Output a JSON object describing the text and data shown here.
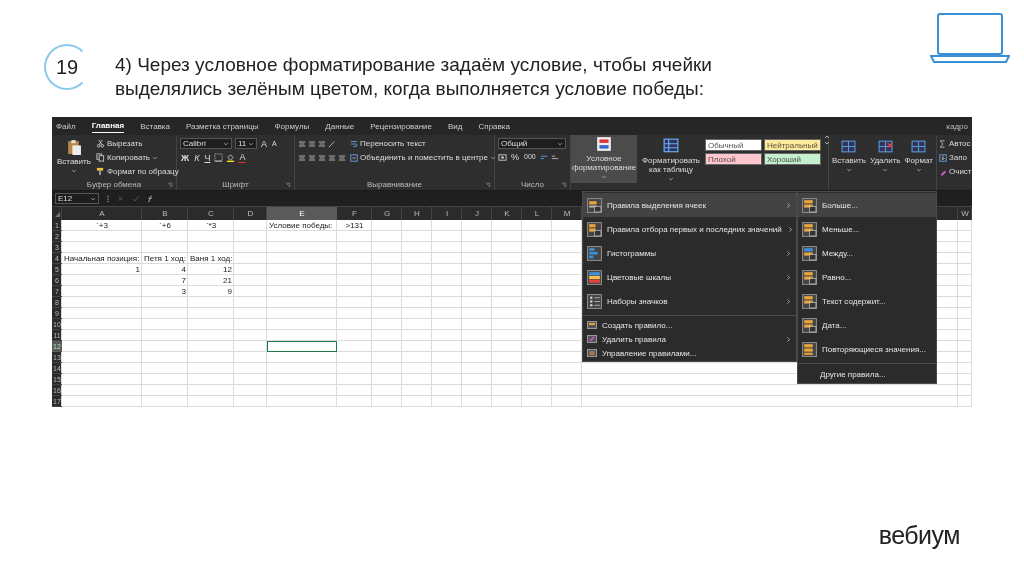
{
  "slide": {
    "number": "19",
    "heading": "4) Через условное форматирование задаём условие, чтобы ячейки выделялись зелёным цветом, когда выполняется условие победы:",
    "brand": "вебиум"
  },
  "excel": {
    "tabs": [
      {
        "label": "Файл",
        "selected": false
      },
      {
        "label": "Главная",
        "selected": true
      },
      {
        "label": "Вставка",
        "selected": false
      },
      {
        "label": "Разметка страницы",
        "selected": false
      },
      {
        "label": "Формулы",
        "selected": false
      },
      {
        "label": "Данные",
        "selected": false
      },
      {
        "label": "Рецензирование",
        "selected": false
      },
      {
        "label": "Вид",
        "selected": false
      },
      {
        "label": "Справка",
        "selected": false
      }
    ],
    "account": "кадро",
    "clipboard": {
      "paste": "Вставить",
      "cut": "Вырезать",
      "copy": "Копировать",
      "format_painter": "Формат по образцу",
      "label": "Буфер обмена"
    },
    "font": {
      "name": "Calibri",
      "size": "11",
      "grow": "A",
      "shrink": "A",
      "bold": "Ж",
      "italic": "К",
      "underline": "Ч",
      "color_letter": "A",
      "label": "Шрифт"
    },
    "alignment": {
      "wrap": "Переносить текст",
      "merge": "Объединить и поместить в центре",
      "label": "Выравнивание"
    },
    "number": {
      "format": "Общий",
      "percent": "%",
      "thousands": "000",
      "label": "Число"
    },
    "styles": {
      "conditional": {
        "label": "Условное форматирование",
        "selected": true
      },
      "format_table": "Форматировать как таблицу",
      "cell_styles": [
        {
          "label": "Обычный",
          "color": "#ffffff"
        },
        {
          "label": "Нейтральный",
          "color": "#ffeb9c"
        },
        {
          "label": "Плохой",
          "color": "#ffc7ce"
        },
        {
          "label": "Хороший",
          "color": "#c6efce"
        }
      ]
    },
    "cells_group": [
      "Вставить",
      "Удалить",
      "Формат"
    ],
    "editing": [
      "Автос",
      "Запо",
      "Очист"
    ],
    "name_box": "E12",
    "columns": [
      {
        "label": "A",
        "selected": false
      },
      {
        "label": "B",
        "selected": false
      },
      {
        "label": "C",
        "selected": false
      },
      {
        "label": "D",
        "selected": false
      },
      {
        "label": "E",
        "selected": true
      },
      {
        "label": "F",
        "selected": false
      },
      {
        "label": "G",
        "selected": false
      },
      {
        "label": "H",
        "selected": false
      },
      {
        "label": "I",
        "selected": false
      },
      {
        "label": "J",
        "selected": false
      },
      {
        "label": "K",
        "selected": false
      },
      {
        "label": "L",
        "selected": false
      },
      {
        "label": "M",
        "selected": false
      },
      {
        "label": "W",
        "selected": false
      }
    ],
    "rows": [
      {
        "number": "1",
        "selected": false,
        "cells": [
          {
            "kind": "centered",
            "text": "`+3"
          },
          {
            "kind": "centered",
            "text": "`+6"
          },
          {
            "kind": "centered",
            "text": "`*3"
          },
          {
            "kind": "blank"
          },
          {
            "kind": "text",
            "text": "Условие победы:"
          },
          {
            "kind": "centered",
            "text": ">131"
          }
        ]
      },
      {
        "number": "2",
        "selected": false
      },
      {
        "number": "3",
        "selected": false
      },
      {
        "number": "4",
        "selected": false,
        "cells": [
          {
            "kind": "text",
            "text": "Начальная позиция:"
          },
          {
            "kind": "text",
            "text": "Петя 1 ход:"
          },
          {
            "kind": "text",
            "text": "Ваня 1 ход:"
          }
        ]
      },
      {
        "number": "5",
        "selected": false,
        "cells": [
          {
            "kind": "number",
            "text": "1"
          },
          {
            "kind": "number",
            "text": "4"
          },
          {
            "kind": "number",
            "text": "12"
          }
        ]
      },
      {
        "number": "6",
        "selected": false,
        "cells": [
          {
            "kind": "blank"
          },
          {
            "kind": "number",
            "text": "7"
          },
          {
            "kind": "number",
            "text": "21"
          }
        ]
      },
      {
        "number": "7",
        "selected": false,
        "cells": [
          {
            "kind": "blank"
          },
          {
            "kind": "number",
            "text": "3"
          },
          {
            "kind": "number",
            "text": "9"
          }
        ]
      },
      {
        "number": "8",
        "selected": false
      },
      {
        "number": "9",
        "selected": false
      },
      {
        "number": "10",
        "selected": false
      },
      {
        "number": "11",
        "selected": false
      },
      {
        "number": "12",
        "selected": true
      },
      {
        "number": "13",
        "selected": false
      },
      {
        "number": "14",
        "selected": false
      },
      {
        "number": "15",
        "selected": false
      },
      {
        "number": "16",
        "selected": false
      },
      {
        "number": "17",
        "selected": false
      }
    ],
    "menu": [
      {
        "kind": "large",
        "label": "Правила выделения ячеек",
        "selected": true,
        "has_submenu": true
      },
      {
        "kind": "large",
        "label": "Правила отбора первых и последних значений",
        "selected": false,
        "has_submenu": true
      },
      {
        "kind": "large",
        "label": "Гистограммы",
        "selected": false,
        "has_submenu": true
      },
      {
        "kind": "large",
        "label": "Цветовые шкалы",
        "selected": false,
        "has_submenu": true
      },
      {
        "kind": "large",
        "label": "Наборы значков",
        "selected": false,
        "has_submenu": true
      },
      {
        "kind": "small",
        "label": "Создать правило...",
        "selected": false,
        "has_submenu": false
      },
      {
        "kind": "small",
        "label": "Удалить правила",
        "selected": false,
        "has_submenu": true
      },
      {
        "kind": "small",
        "label": "Управление правилами...",
        "selected": false,
        "has_submenu": false
      }
    ],
    "submenu": [
      {
        "label": "Больше...",
        "selected": true
      },
      {
        "label": "Меньше...",
        "selected": false
      },
      {
        "label": "Между...",
        "selected": false
      },
      {
        "label": "Равно...",
        "selected": false
      },
      {
        "label": "Текст содержит...",
        "selected": false
      },
      {
        "label": "Дата...",
        "selected": false
      },
      {
        "label": "Повторяющиеся значения...",
        "selected": false
      }
    ],
    "submenu_footer": "Другие правила..."
  }
}
